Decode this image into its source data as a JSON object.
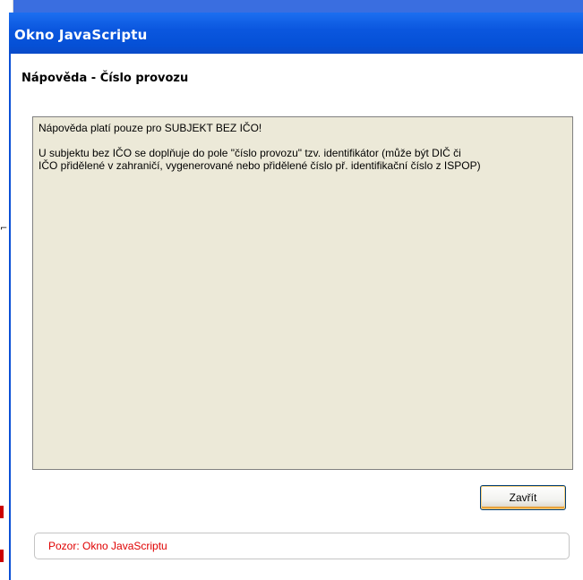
{
  "window": {
    "title": "Okno JavaScriptu"
  },
  "help": {
    "heading": "Nápověda - Číslo provozu",
    "line1": "Nápověda platí pouze pro SUBJEKT BEZ IČO!",
    "line2": "U subjektu bez IČO se doplňuje do pole \"číslo provozu\" tzv. identifikátor (může být DIČ či",
    "line3": "IČO přidělené v zahraničí, vygenerované nebo přidělené číslo př. identifikační číslo z ISPOP)"
  },
  "buttons": {
    "close_label": "Zavřít"
  },
  "status": {
    "text": "Pozor: Okno JavaScriptu"
  },
  "colors": {
    "titlebar": "#0b57df",
    "content_bg": "#ece9d8",
    "status_text": "#e00000"
  }
}
